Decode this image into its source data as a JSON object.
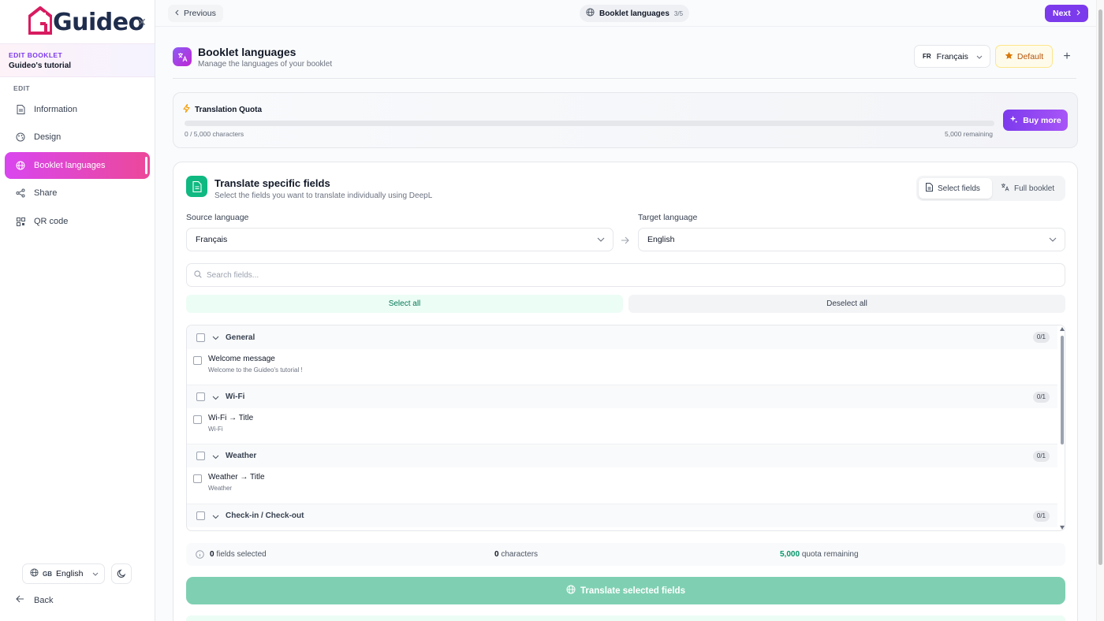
{
  "brand": {
    "name": "Guideo",
    "accent": "#d81b60"
  },
  "sidebar": {
    "edit_label": "EDIT BOOKLET",
    "booklet_name": "Guideo's tutorial",
    "section_label": "EDIT",
    "items": [
      {
        "label": "Information",
        "icon": "document-icon",
        "active": false
      },
      {
        "label": "Design",
        "icon": "palette-icon",
        "active": false
      },
      {
        "label": "Booklet languages",
        "icon": "globe-icon",
        "active": true
      },
      {
        "label": "Share",
        "icon": "share-icon",
        "active": false
      },
      {
        "label": "QR code",
        "icon": "qr-code-icon",
        "active": false
      }
    ],
    "language": {
      "flag": "GB",
      "label": "English"
    },
    "back_label": "Back"
  },
  "topbar": {
    "prev_label": "Previous",
    "step_label": "Booklet languages",
    "step_count": "3/5",
    "next_label": "Next"
  },
  "header": {
    "title": "Booklet languages",
    "subtitle": "Manage the languages of your booklet",
    "lang_flag": "FR",
    "lang_label": "Français",
    "default_label": "Default"
  },
  "quota": {
    "title": "Translation Quota",
    "used_text": "0 / 5,000 characters",
    "remaining_text": "5,000 remaining",
    "used_fraction": 0,
    "buy_label": "Buy more"
  },
  "translate_card": {
    "title": "Translate specific fields",
    "subtitle": "Select the fields you want to translate individually using DeepL",
    "mode_select": "Select fields",
    "mode_full": "Full booklet",
    "source_label": "Source language",
    "source_value": "Français",
    "target_label": "Target language",
    "target_value": "English",
    "search_placeholder": "Search fields...",
    "select_all": "Select all",
    "deselect_all": "Deselect all",
    "groups": [
      {
        "name": "General",
        "badge": "0/1",
        "field_title": "Welcome message",
        "field_sub": "Welcome to the Guideo's tutorial !"
      },
      {
        "name": "Wi-Fi",
        "badge": "0/1",
        "field_title": "Wi-Fi → Title",
        "field_sub": "Wi-Fi"
      },
      {
        "name": "Weather",
        "badge": "0/1",
        "field_title": "Weather → Title",
        "field_sub": "Weather"
      },
      {
        "name": "Check-in / Check-out",
        "badge": "0/1"
      }
    ],
    "summary": {
      "fields_count": "0",
      "fields_text": "fields selected",
      "chars_count": "0",
      "chars_text": "characters",
      "quota_count": "5,000",
      "quota_text": "quota remaining"
    },
    "translate_label": "Translate selected fields"
  }
}
